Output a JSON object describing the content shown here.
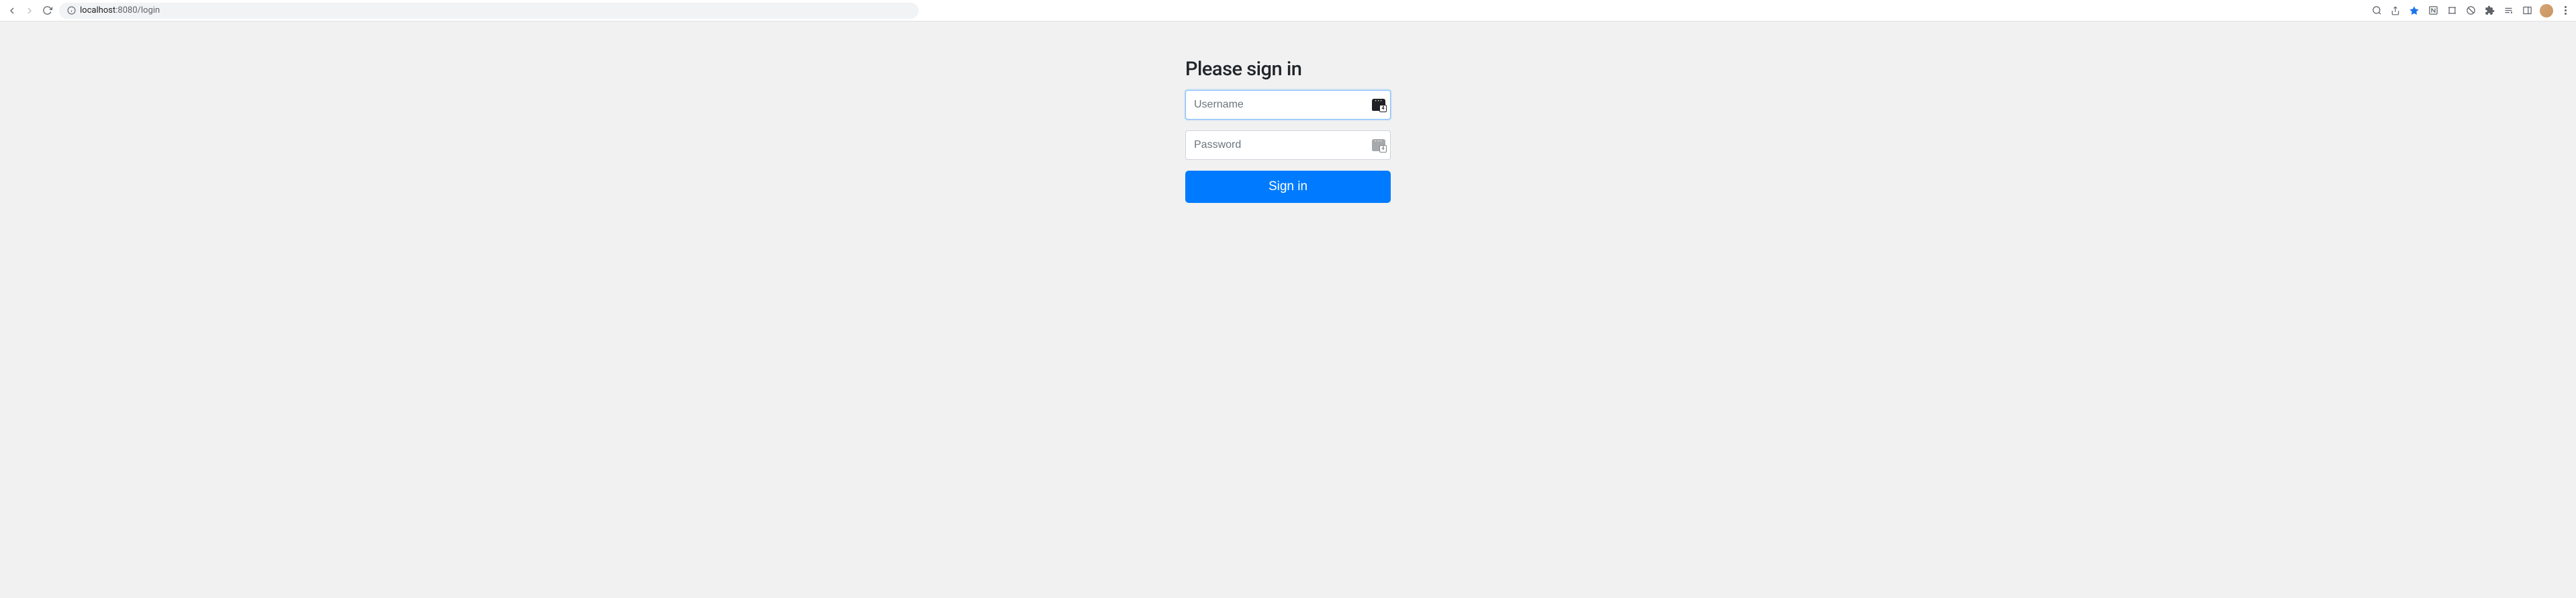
{
  "browser": {
    "url": {
      "host": "localhost",
      "port": ":8080",
      "path": "/login"
    }
  },
  "login": {
    "heading": "Please sign in",
    "username": {
      "placeholder": "Username",
      "value": ""
    },
    "password": {
      "placeholder": "Password",
      "value": ""
    },
    "submit_label": "Sign in",
    "pwmgr_badge": "4"
  }
}
